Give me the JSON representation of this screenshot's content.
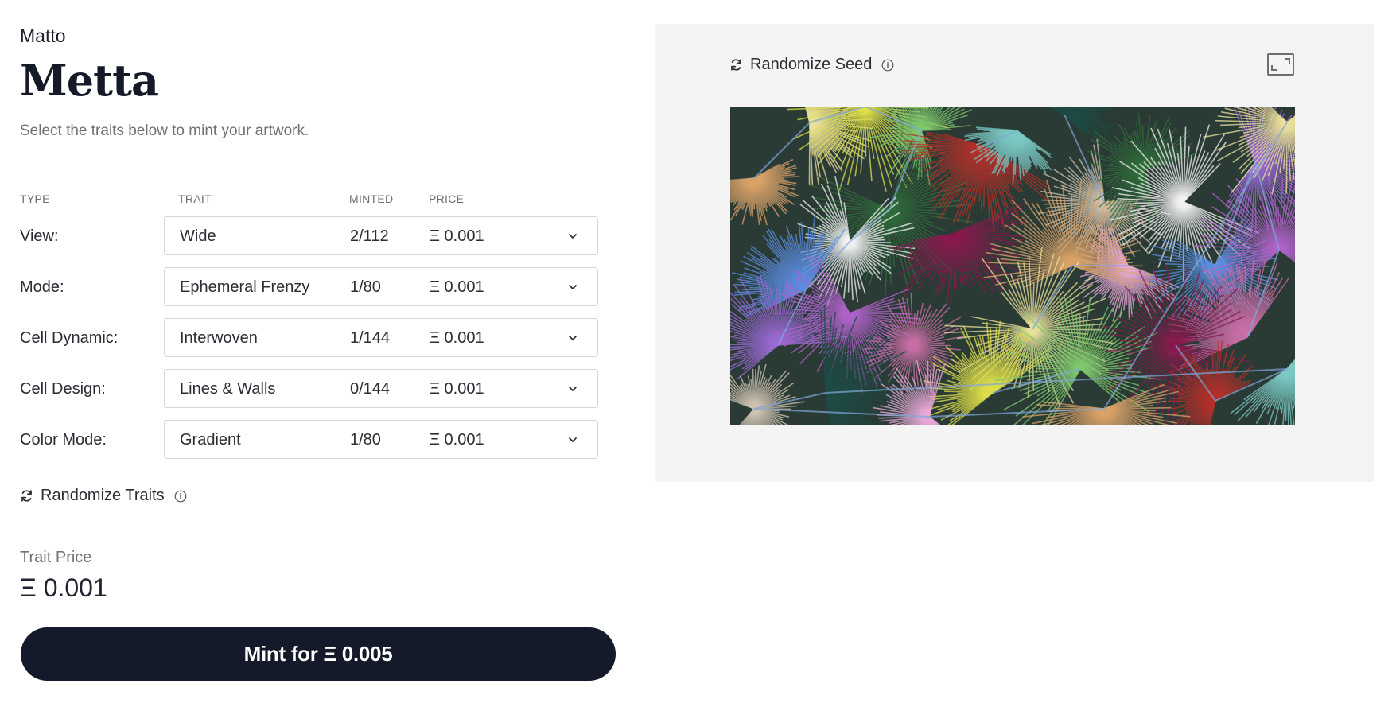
{
  "header": {
    "artist": "Matto",
    "title": "Metta",
    "subtitle": "Select the traits below to mint your artwork."
  },
  "table": {
    "columns": [
      "TYPE",
      "TRAIT",
      "MINTED",
      "PRICE"
    ],
    "rows": [
      {
        "type": "View:",
        "trait": "Wide",
        "minted": "2/112",
        "price": "Ξ 0.001"
      },
      {
        "type": "Mode:",
        "trait": "Ephemeral Frenzy",
        "minted": "1/80",
        "price": "Ξ 0.001"
      },
      {
        "type": "Cell Dynamic:",
        "trait": "Interwoven",
        "minted": "1/144",
        "price": "Ξ 0.001"
      },
      {
        "type": "Cell Design:",
        "trait": "Lines & Walls",
        "minted": "0/144",
        "price": "Ξ 0.001"
      },
      {
        "type": "Color Mode:",
        "trait": "Gradient",
        "minted": "1/80",
        "price": "Ξ 0.001"
      }
    ]
  },
  "randomize_traits": {
    "label": "Randomize Traits",
    "icon": "refresh-icon",
    "info_icon": "info-icon"
  },
  "trait_price": {
    "label": "Trait Price",
    "value": "Ξ 0.001"
  },
  "mint_button": {
    "label": "Mint for Ξ 0.005"
  },
  "preview": {
    "randomize_seed_label": "Randomize Seed",
    "seed_icon": "refresh-icon",
    "info_icon": "info-icon",
    "expand_icon": "expand-icon",
    "panel_bg": "#f4f4f4",
    "artwork_palette": [
      "#d9a36a",
      "#e9e09c",
      "#dfe04a",
      "#7fc86e",
      "#2f6d3a",
      "#f2f2f2",
      "#5b8ee0",
      "#9a6ad4",
      "#b063c9",
      "#c96fa7",
      "#8a1a4e",
      "#b5302a",
      "#7cc9c4",
      "#1d4b46",
      "#cfc3b0",
      "#e8a9d8"
    ]
  },
  "theme": {
    "accent": "#141a29",
    "text": "#1f2430",
    "muted": "#6e7076",
    "border": "#d3d6da"
  }
}
